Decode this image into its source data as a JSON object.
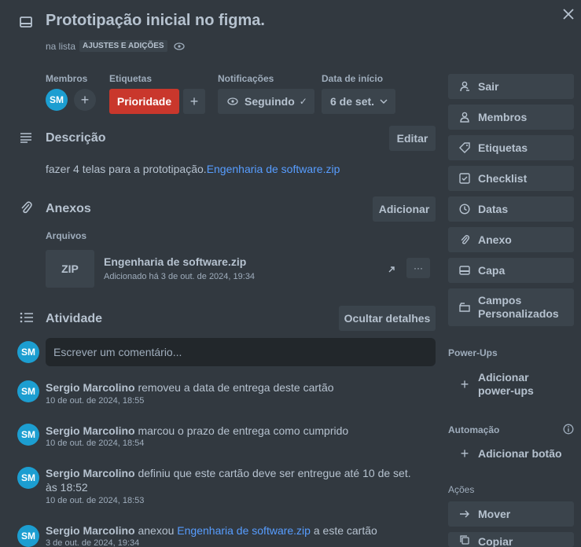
{
  "card": {
    "title": "Prototipação inicial no figma.",
    "list_prefix": "na lista",
    "list_name": "AJUSTES E ADIÇÕES"
  },
  "fields": {
    "members_label": "Membros",
    "member_initials": "SM",
    "labels_label": "Etiquetas",
    "label_name": "Prioridade",
    "label_color": "#c9372c",
    "notifications_label": "Notificações",
    "notifications_value": "Seguindo",
    "start_label": "Data de início",
    "start_value": "6 de set."
  },
  "description": {
    "title": "Descrição",
    "edit_label": "Editar",
    "text": "fazer 4 telas para a prototipação.",
    "link": "Engenharia de software.zip"
  },
  "attachments": {
    "title": "Anexos",
    "add_label": "Adicionar",
    "files_label": "Arquivos",
    "file": {
      "type": "ZIP",
      "name": "Engenharia de software.zip",
      "added": "Adicionado há 3 de out. de 2024, 19:34",
      "more": "···"
    }
  },
  "activity": {
    "title": "Atividade",
    "hide_label": "Ocultar detalhes",
    "comment_placeholder": "Escrever um comentário...",
    "items": [
      {
        "initials": "SM",
        "name": "Sergio Marcolino",
        "text": " removeu a data de entrega deste cartão",
        "time": "10 de out. de 2024, 18:55"
      },
      {
        "initials": "SM",
        "name": "Sergio Marcolino",
        "text": " marcou o prazo de entrega como cumprido",
        "time": "10 de out. de 2024, 18:54"
      },
      {
        "initials": "SM",
        "name": "Sergio Marcolino",
        "text": " definiu que este cartão deve ser entregue até 10 de set. às 18:52",
        "time": "10 de out. de 2024, 18:53"
      },
      {
        "initials": "SM",
        "name": "Sergio Marcolino",
        "text_before": " anexou ",
        "link": "Engenharia de software.zip",
        "text_after": " a este cartão",
        "time": "3 de out. de 2024, 19:34"
      }
    ]
  },
  "sidebar": {
    "buttons": [
      {
        "icon": "leave-icon",
        "label": "Sair"
      },
      {
        "icon": "members-icon",
        "label": "Membros"
      },
      {
        "icon": "tag-icon",
        "label": "Etiquetas"
      },
      {
        "icon": "checklist-icon",
        "label": "Checklist"
      },
      {
        "icon": "clock-icon",
        "label": "Datas"
      },
      {
        "icon": "paperclip-icon",
        "label": "Anexo"
      },
      {
        "icon": "cover-icon",
        "label": "Capa"
      },
      {
        "icon": "custom-fields-icon",
        "label": "Campos Personalizados"
      }
    ],
    "powerups_label": "Power-Ups",
    "add_powerups_label": "Adicionar power-ups",
    "automation_label": "Automação",
    "add_button_label": "Adicionar botão",
    "actions_label": "Ações",
    "move_label": "Mover",
    "copy_label": "Copiar"
  },
  "colors": {
    "background": "#323940",
    "button": "#3b444c",
    "avatar": "#1c9ed1",
    "link": "#579dff"
  }
}
